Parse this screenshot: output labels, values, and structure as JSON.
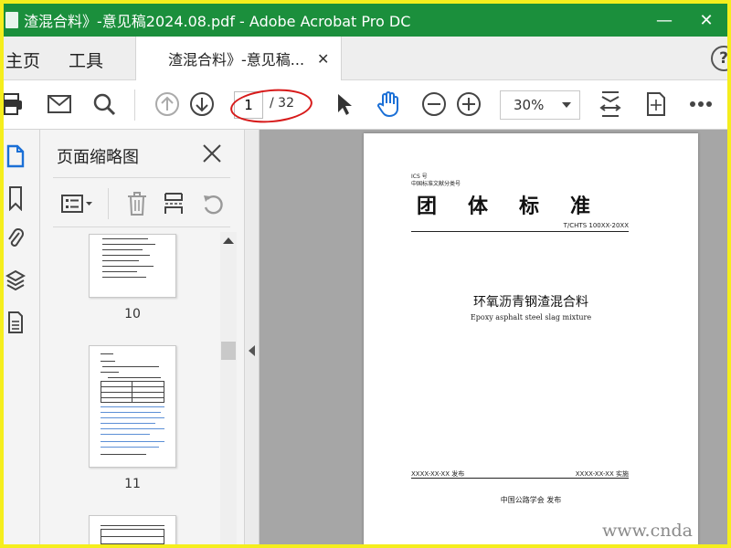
{
  "window": {
    "title": "渣混合料》-意见稿2024.08.pdf - Adobe Acrobat Pro DC",
    "minimize": "—",
    "close": "✕"
  },
  "tabs": {
    "home": "主页",
    "tools": "工具",
    "document": "渣混合料》-意见稿...",
    "document_close": "✕",
    "help": "?"
  },
  "toolbar": {
    "current_page": "1",
    "total_pages": "/ 32",
    "zoom": "30%"
  },
  "thumbnails": {
    "title": "页面缩略图",
    "pages": [
      {
        "label": "10"
      },
      {
        "label": "11"
      }
    ]
  },
  "document": {
    "ics": "ICS 号",
    "classification": "中国标准文献分类号",
    "heading": "团体标准",
    "code": "T/CHTS 100XX-20XX",
    "title_cn": "环氧沥青钢渣混合料",
    "title_en": "Epoxy asphalt steel slag mixture",
    "publish": "XXXX-XX-XX 发布",
    "implement": "XXXX-XX-XX 实施",
    "organization": "中国公路学会 发布"
  },
  "watermark": "www.cnda",
  "colors": {
    "titlebar": "#1b8f3c",
    "accent_blue": "#1a6fd6",
    "annotation_red": "#d71a1a"
  }
}
